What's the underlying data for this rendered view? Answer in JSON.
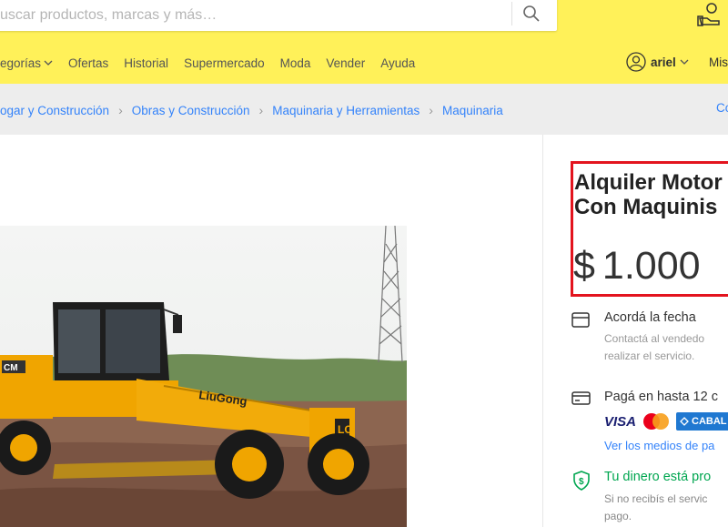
{
  "search": {
    "placeholder": "uscar productos, marcas y más…"
  },
  "nav": {
    "items": [
      "egorías",
      "Ofertas",
      "Historial",
      "Supermercado",
      "Moda",
      "Vender",
      "Ayuda"
    ]
  },
  "user": {
    "name": "ariel",
    "mis": "Mis"
  },
  "breadcrumb": {
    "items": [
      "ogar y Construcción",
      "Obras y Construcción",
      "Maquinaria y Herramientas",
      "Maquinaria"
    ],
    "right": "Co"
  },
  "product": {
    "title_line1": "Alquiler Motor",
    "title_line2": "Con Maquinis",
    "currency": "$",
    "price": "1.000",
    "image_brand_text": "LiuGong",
    "image_model_text": "CM"
  },
  "features": {
    "date_title": "Acordá la fecha",
    "date_sub1": "Contactá al vendedo",
    "date_sub2": "realizar el servicio.",
    "pay_title": "Pagá en hasta 12 c",
    "pay_link": "Ver los medios de pa",
    "card_visa": "VISA",
    "card_cabal": "CABAL",
    "protect_title": "Tu dinero está pro",
    "protect_sub1": "Si no recibís el servic",
    "protect_sub2": "pago."
  },
  "colors": {
    "header_yellow": "#fff159",
    "link_blue": "#3483fa",
    "highlight_red": "#e3141e",
    "green": "#00a650"
  }
}
